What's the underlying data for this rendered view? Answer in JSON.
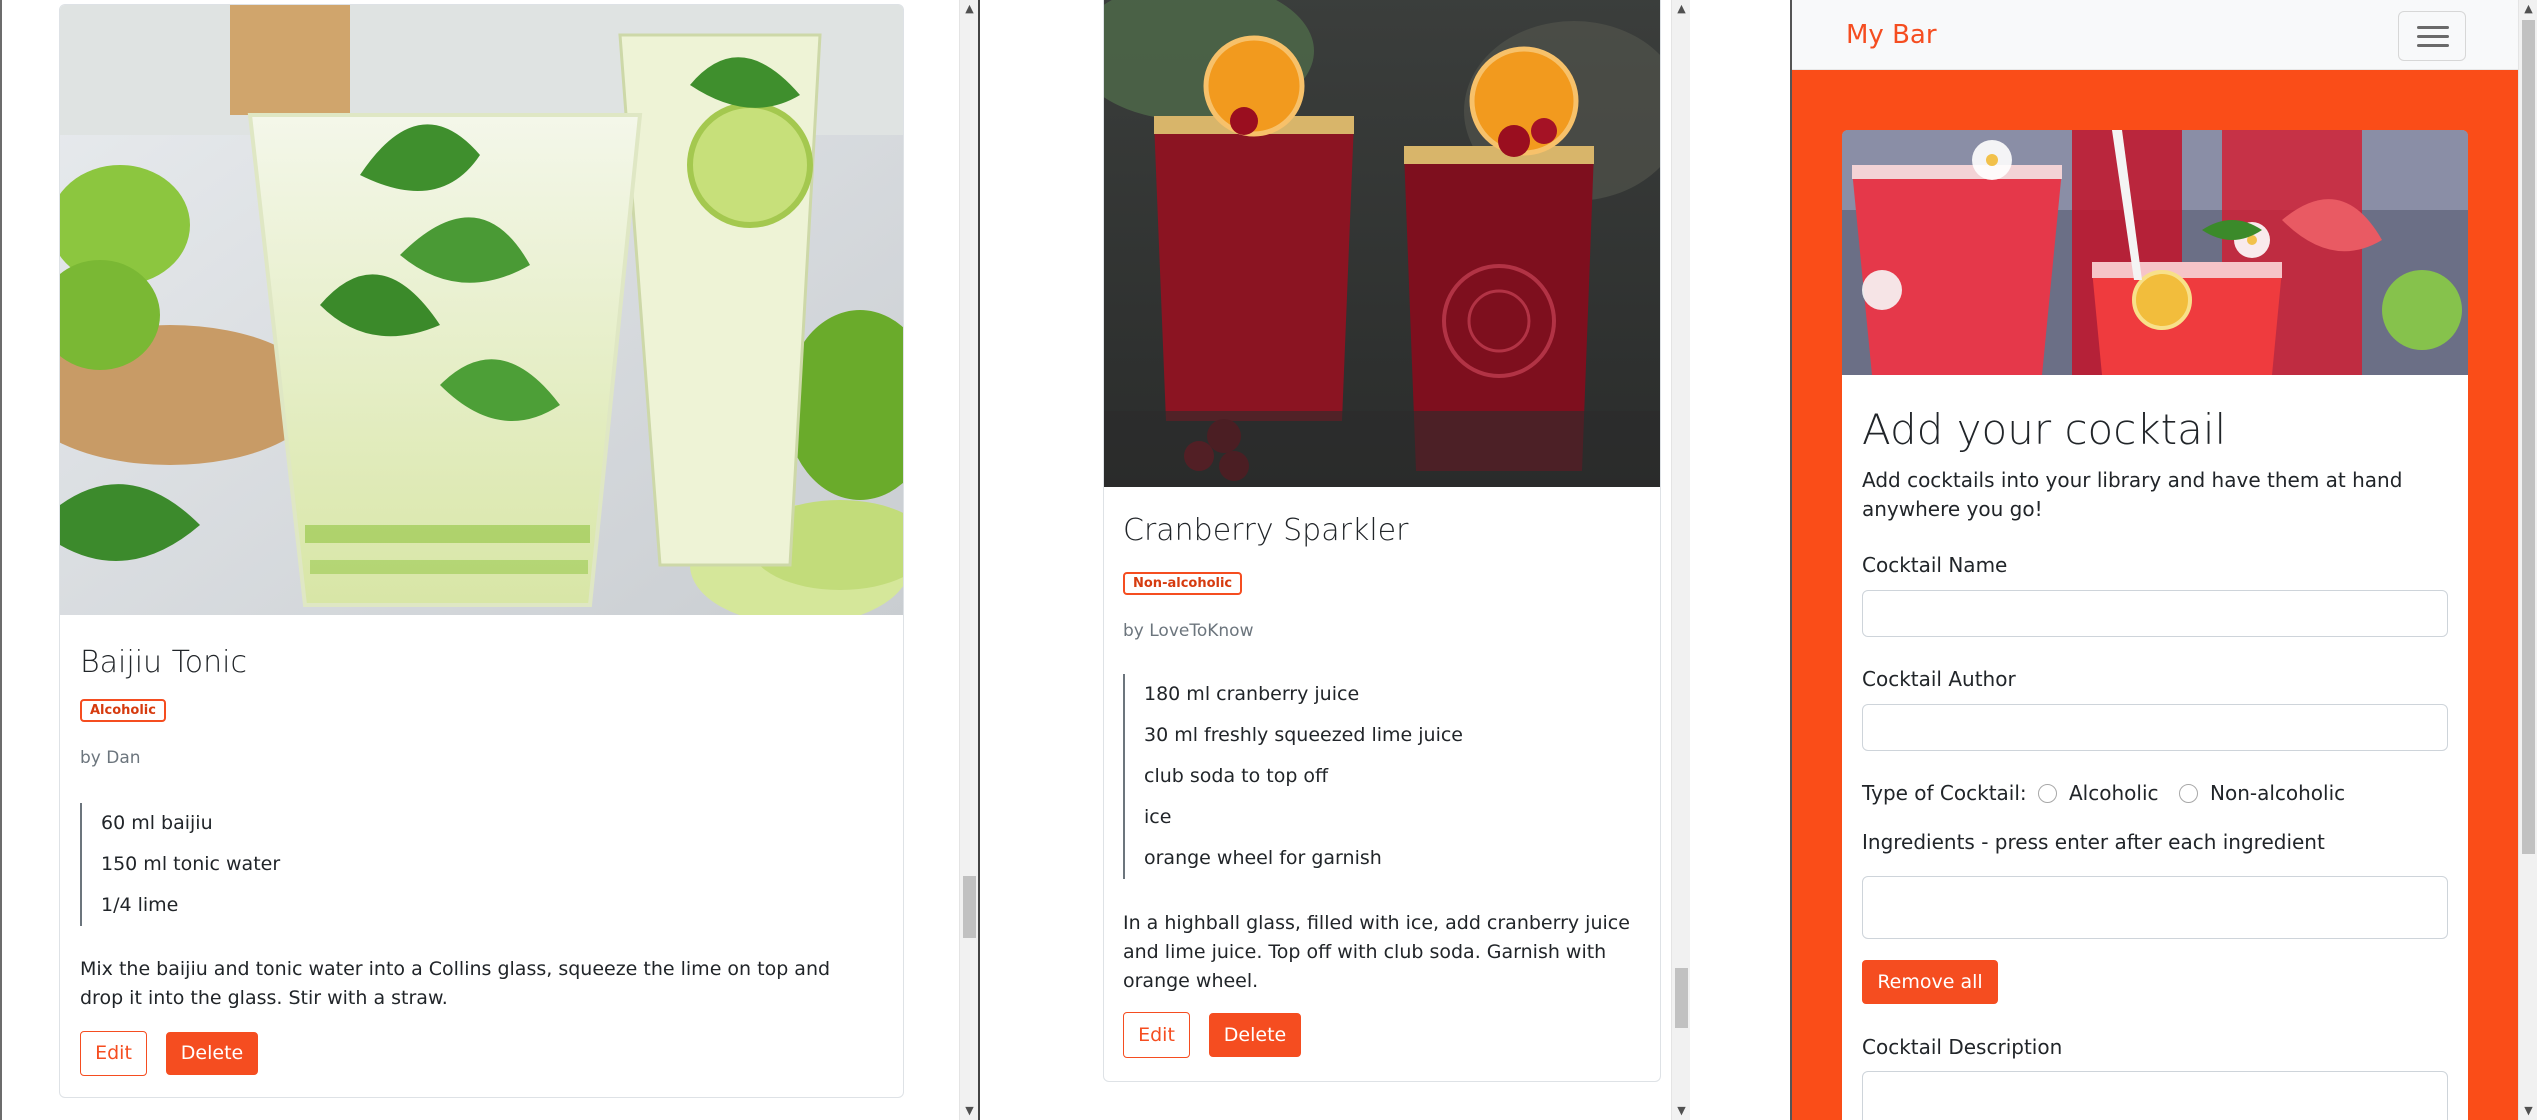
{
  "left_card": {
    "title": "Baijiu Tonic",
    "badge": "Alcoholic",
    "author": "by Dan",
    "ingredients": [
      "60 ml baijiu",
      "150 ml tonic water",
      "1/4 lime"
    ],
    "description": "Mix the baijiu and tonic water into a Collins glass, squeeze the lime on top and drop it into the glass. Stir with a straw.",
    "edit_label": "Edit",
    "delete_label": "Delete"
  },
  "middle_card": {
    "title": "Cranberry Sparkler",
    "badge": "Non-alcoholic",
    "author": "by LoveToKnow",
    "ingredients": [
      "180 ml cranberry juice",
      "30 ml freshly squeezed lime juice",
      "club soda to top off",
      "ice",
      "orange wheel for garnish"
    ],
    "description": "In a highball glass, filled with ice, add cranberry juice and lime juice. Top off with club soda. Garnish with orange wheel.",
    "edit_label": "Edit",
    "delete_label": "Delete"
  },
  "navbar": {
    "brand": "My Bar",
    "toggler_icon": "hamburger-icon"
  },
  "form": {
    "title": "Add your cocktail",
    "lead": "Add cocktails into your library and have them at hand anywhere you go!",
    "name_label": "Cocktail Name",
    "name_value": "",
    "author_label": "Cocktail Author",
    "author_value": "",
    "type_label": "Type of Cocktail:",
    "type_options": [
      "Alcoholic",
      "Non-alcoholic"
    ],
    "ingredients_label": "Ingredients - press enter after each ingredient",
    "ingredients_value": "",
    "remove_all_label": "Remove all",
    "description_label": "Cocktail Description"
  },
  "colors": {
    "accent": "#f54d20",
    "page_background": "#fa4d18",
    "navbar": "#f8f9fa"
  }
}
